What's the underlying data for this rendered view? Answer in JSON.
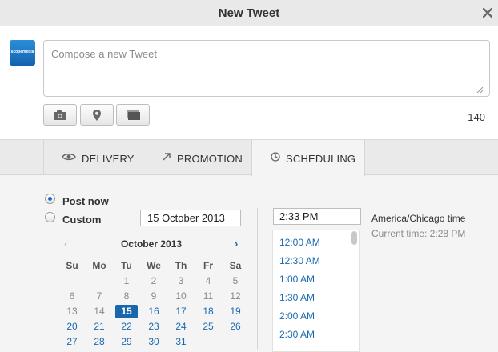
{
  "window": {
    "title": "New Tweet"
  },
  "avatar": {
    "brand_text": "scopemedia"
  },
  "compose": {
    "placeholder": "Compose a new Tweet",
    "value": "",
    "char_count": "140"
  },
  "tabs": [
    {
      "label": "DELIVERY",
      "icon": "eye-icon",
      "active": false
    },
    {
      "label": "PROMOTION",
      "icon": "arrow-up-right-icon",
      "active": false
    },
    {
      "label": "SCHEDULING",
      "icon": "clock-icon",
      "active": true
    }
  ],
  "scheduling": {
    "post_now_label": "Post now",
    "custom_label": "Custom",
    "selected_option": "Post now",
    "date_value": "15 October 2013",
    "calendar": {
      "month_title": "October 2013",
      "prev_glyph": "‹",
      "next_glyph": "›",
      "weekdays": [
        "Su",
        "Mo",
        "Tu",
        "We",
        "Th",
        "Fr",
        "Sa"
      ],
      "weeks": [
        [
          "",
          "",
          "1",
          "2",
          "3",
          "4",
          "5"
        ],
        [
          "6",
          "7",
          "8",
          "9",
          "10",
          "11",
          "12"
        ],
        [
          "13",
          "14",
          "15",
          "16",
          "17",
          "18",
          "19"
        ],
        [
          "20",
          "21",
          "22",
          "23",
          "24",
          "25",
          "26"
        ],
        [
          "27",
          "28",
          "29",
          "30",
          "31",
          "",
          ""
        ]
      ],
      "today": "15"
    },
    "time_value": "2:33 PM",
    "time_options": [
      "12:00 AM",
      "12:30 AM",
      "1:00 AM",
      "1:30 AM",
      "2:00 AM",
      "2:30 AM"
    ],
    "timezone": "America/Chicago time",
    "current_time": "Current time: 2:28 PM"
  },
  "colors": {
    "accent": "#1a6ab0",
    "today_bg": "#1a66ad",
    "avatar": "#1d7ac4"
  }
}
